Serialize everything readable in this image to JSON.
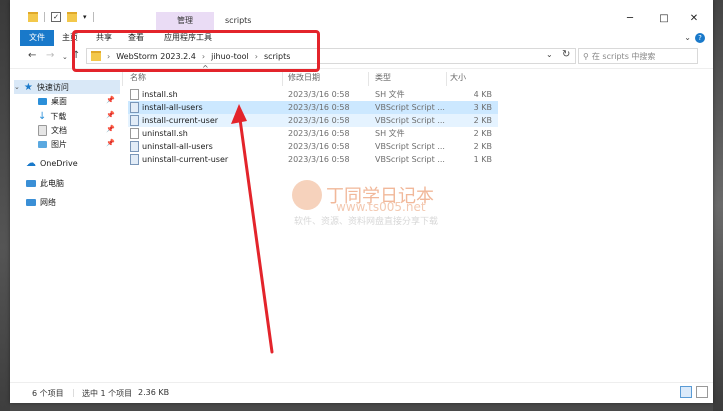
{
  "window": {
    "title": "scripts",
    "context_tab": "管理"
  },
  "ribbon": {
    "tabs": [
      "文件",
      "主页",
      "共享",
      "查看",
      "应用程序工具"
    ]
  },
  "address": {
    "parts": [
      "WebStorm 2023.2.4",
      "jihuo-tool",
      "scripts"
    ]
  },
  "search": {
    "placeholder": "在 scripts 中搜索"
  },
  "sidebar": {
    "items": [
      {
        "label": "快速访问",
        "icon": "star-icon"
      },
      {
        "label": "桌面",
        "icon": "desktop-icon"
      },
      {
        "label": "下载",
        "icon": "download-icon"
      },
      {
        "label": "文档",
        "icon": "document-icon"
      },
      {
        "label": "图片",
        "icon": "picture-icon"
      },
      {
        "label": "OneDrive",
        "icon": "cloud-icon"
      },
      {
        "label": "此电脑",
        "icon": "computer-icon"
      },
      {
        "label": "网络",
        "icon": "network-icon"
      }
    ]
  },
  "columns": {
    "name": "名称",
    "date": "修改日期",
    "type": "类型",
    "size": "大小"
  },
  "files": [
    {
      "name": "install.sh",
      "date": "2023/3/16 0:58",
      "type": "SH 文件",
      "size": "4 KB"
    },
    {
      "name": "install-all-users",
      "date": "2023/3/16 0:58",
      "type": "VBScript Script ...",
      "size": "3 KB"
    },
    {
      "name": "install-current-user",
      "date": "2023/3/16 0:58",
      "type": "VBScript Script ...",
      "size": "2 KB"
    },
    {
      "name": "uninstall.sh",
      "date": "2023/3/16 0:58",
      "type": "SH 文件",
      "size": "2 KB"
    },
    {
      "name": "uninstall-all-users",
      "date": "2023/3/16 0:58",
      "type": "VBScript Script ...",
      "size": "2 KB"
    },
    {
      "name": "uninstall-current-user",
      "date": "2023/3/16 0:58",
      "type": "VBScript Script ...",
      "size": "1 KB"
    }
  ],
  "watermark": {
    "title": "丁同学日记本",
    "url": "www.ts005.net",
    "subtitle": "软件、资源、资料网盘直接分享下载"
  },
  "status": {
    "count": "6 个项目",
    "selected": "选中 1 个项目",
    "size": "2.36 KB"
  },
  "colors": {
    "accent": "#1979ca",
    "annotation": "#e3242b",
    "selection": "#cce8ff"
  }
}
